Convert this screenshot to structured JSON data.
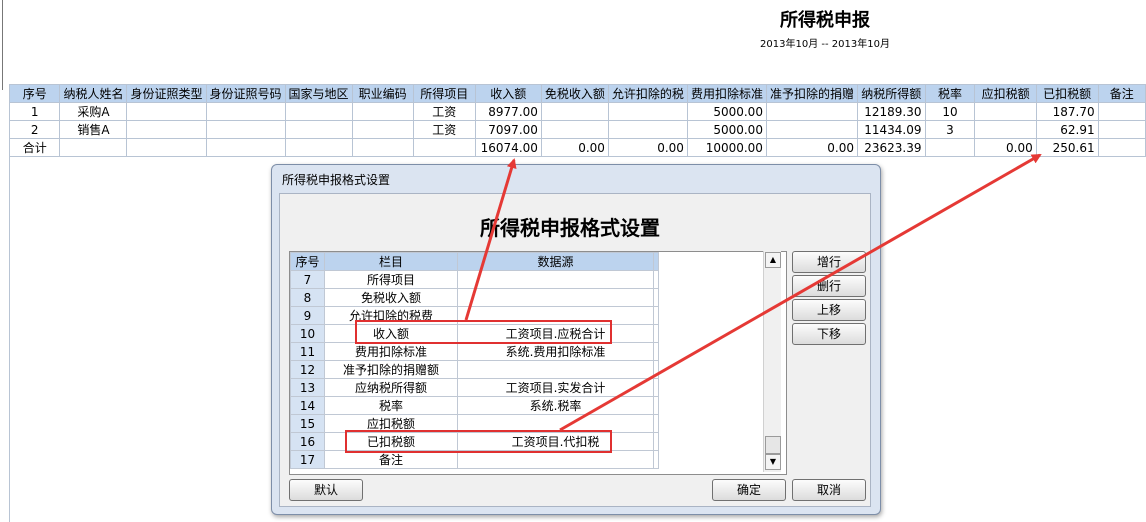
{
  "report": {
    "title": "所得税申报",
    "period": "2013年10月 -- 2013年10月",
    "columns": [
      "序号",
      "纳税人姓名",
      "身份证照类型",
      "身份证照号码",
      "国家与地区",
      "职业编码",
      "所得项目",
      "收入额",
      "免税收入额",
      "允许扣除的税",
      "费用扣除标准",
      "准予扣除的捐赠",
      "纳税所得额",
      "税率",
      "应扣税额",
      "已扣税额",
      "备注"
    ],
    "rows": [
      [
        "1",
        "采购A",
        "",
        "",
        "",
        "",
        "工资",
        "8977.00",
        "",
        "",
        "5000.00",
        "",
        "12189.30",
        "10",
        "",
        "187.70",
        ""
      ],
      [
        "2",
        "销售A",
        "",
        "",
        "",
        "",
        "工资",
        "7097.00",
        "",
        "",
        "5000.00",
        "",
        "11434.09",
        "3",
        "",
        "62.91",
        ""
      ],
      [
        "合计",
        "",
        "",
        "",
        "",
        "",
        "",
        "16074.00",
        "0.00",
        "0.00",
        "10000.00",
        "0.00",
        "23623.39",
        "",
        "0.00",
        "250.61",
        ""
      ]
    ]
  },
  "dialog": {
    "caption": "所得税申报格式设置",
    "heading": "所得税申报格式设置",
    "grid_headers": [
      "序号",
      "栏目",
      "数据源"
    ],
    "grid_rows": [
      [
        "7",
        "所得项目",
        ""
      ],
      [
        "8",
        "免税收入额",
        ""
      ],
      [
        "9",
        "允许扣除的税费",
        ""
      ],
      [
        "10",
        "收入额",
        "工资项目.应税合计"
      ],
      [
        "11",
        "费用扣除标准",
        "系统.费用扣除标准"
      ],
      [
        "12",
        "准予扣除的捐赠额",
        ""
      ],
      [
        "13",
        "应纳税所得额",
        "工资项目.实发合计"
      ],
      [
        "14",
        "税率",
        "系统.税率"
      ],
      [
        "15",
        "应扣税额",
        ""
      ],
      [
        "16",
        "已扣税额",
        "工资项目.代扣税"
      ],
      [
        "17",
        "备注",
        ""
      ]
    ],
    "buttons": {
      "add": "增行",
      "delete": "删行",
      "up": "上移",
      "down": "下移",
      "default": "默认",
      "ok": "确定",
      "cancel": "取消"
    }
  },
  "colors": {
    "header_bg": "#bcd3ee",
    "highlight": "#e03030",
    "dialog_bg": "#dbe4f1"
  }
}
